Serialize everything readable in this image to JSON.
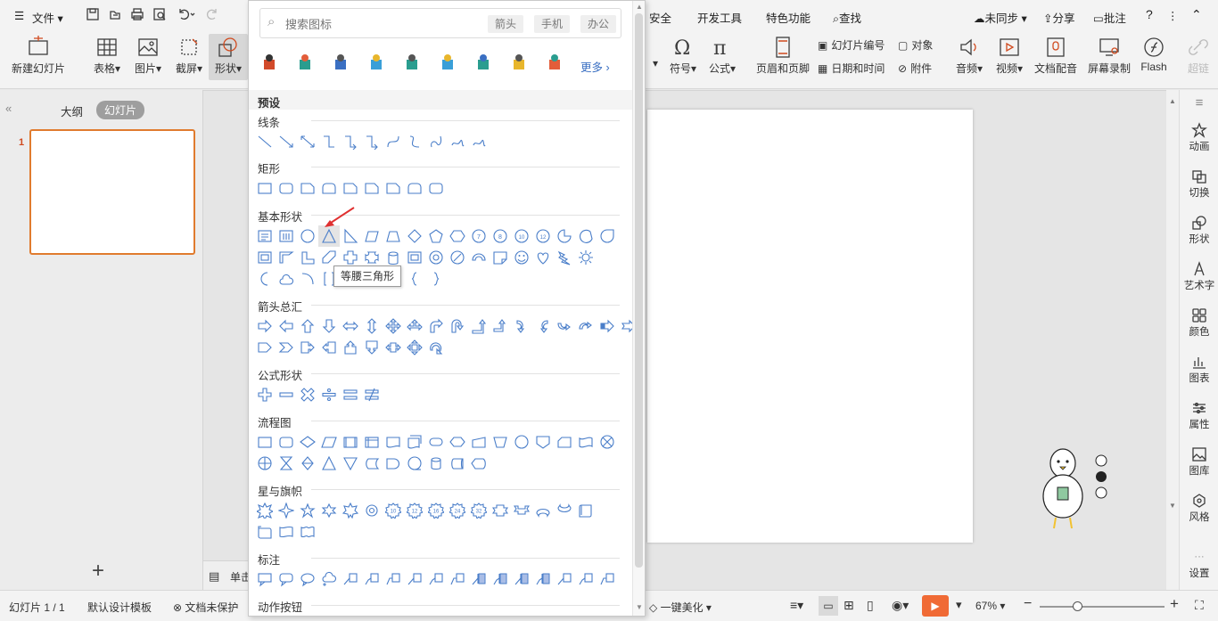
{
  "menubar": {
    "file": "文件",
    "security": "安全",
    "developer": "开发工具",
    "special": "特色功能",
    "find": "查找",
    "sync": "未同步",
    "share": "分享",
    "comment": "批注",
    "help": "?"
  },
  "ribbon": {
    "new_slide": "新建幻灯片",
    "table": "表格",
    "picture": "图片",
    "crop": "截屏",
    "shape": "形状",
    "symbol": "符号",
    "formula": "公式",
    "header_footer": "页眉和页脚",
    "slide_number": "幻灯片编号",
    "date_time": "日期和时间",
    "object": "对象",
    "attachment": "附件",
    "audio": "音频",
    "video": "视频",
    "doc_dub": "文档配音",
    "screen_record": "屏幕录制",
    "flash": "Flash",
    "hyperlink": "超链"
  },
  "left_panel": {
    "outline_tab": "大纲",
    "slides_tab": "幻灯片",
    "slide_number": "1",
    "add": "+"
  },
  "notes_label": "单击",
  "right_sidebar": [
    "动画",
    "切换",
    "形状",
    "艺术字",
    "颜色",
    "图表",
    "属性",
    "图库",
    "风格",
    "设置"
  ],
  "status_bar": {
    "slide_info": "幻灯片 1 / 1",
    "design": "默认设计模板",
    "protect": "文档未保护",
    "beautify": "一键美化",
    "zoom": "67%"
  },
  "shape_panel": {
    "search_placeholder": "搜索图标",
    "tags": [
      "箭头",
      "手机",
      "办公"
    ],
    "more": "更多",
    "preset": "预设",
    "sections": {
      "lines": "线条",
      "rect": "矩形",
      "basic": "基本形状",
      "arrows": "箭头总汇",
      "formula": "公式形状",
      "flowchart": "流程图",
      "stars": "星与旗帜",
      "callouts": "标注",
      "action": "动作按钮"
    },
    "tooltip": "等腰三角形"
  },
  "colors": {
    "accent": "#4a7ec9",
    "selected_slide_border": "#e07b2e",
    "record_button": "#f06a35",
    "tooltip_arrow": "#e03030"
  }
}
